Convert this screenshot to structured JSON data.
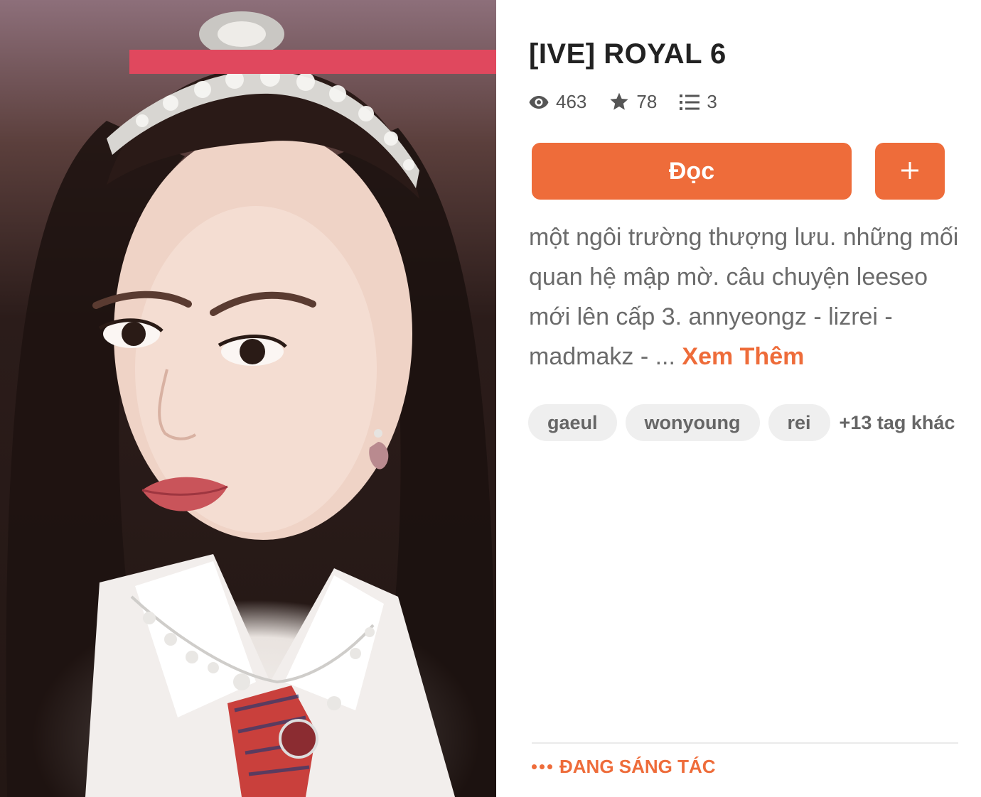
{
  "story": {
    "title": "[IVE] ROYAL 6",
    "stats": {
      "views": "463",
      "votes": "78",
      "parts": "3"
    },
    "read_label": "Đọc",
    "description": "một ngôi trường thượng lưu. những mối quan hệ mập mờ. câu chuyện leeseo mới lên cấp 3. annyeongz - lizrei - madmakz - ...",
    "more_label": "Xem Thêm",
    "tags": [
      "gaeul",
      "wonyoung",
      "rei"
    ],
    "more_tags": "+13 tag khác",
    "status": "ĐANG SÁNG TÁC"
  },
  "icons": {
    "views": "eye-icon",
    "votes": "star-icon",
    "parts": "list-icon",
    "add": "plus-icon",
    "status": "ellipsis-icon"
  },
  "colors": {
    "accent": "#ee6c3a",
    "cover_band": "#e0485e",
    "tag_bg": "#efefef",
    "text_muted": "#6b6b6b"
  }
}
